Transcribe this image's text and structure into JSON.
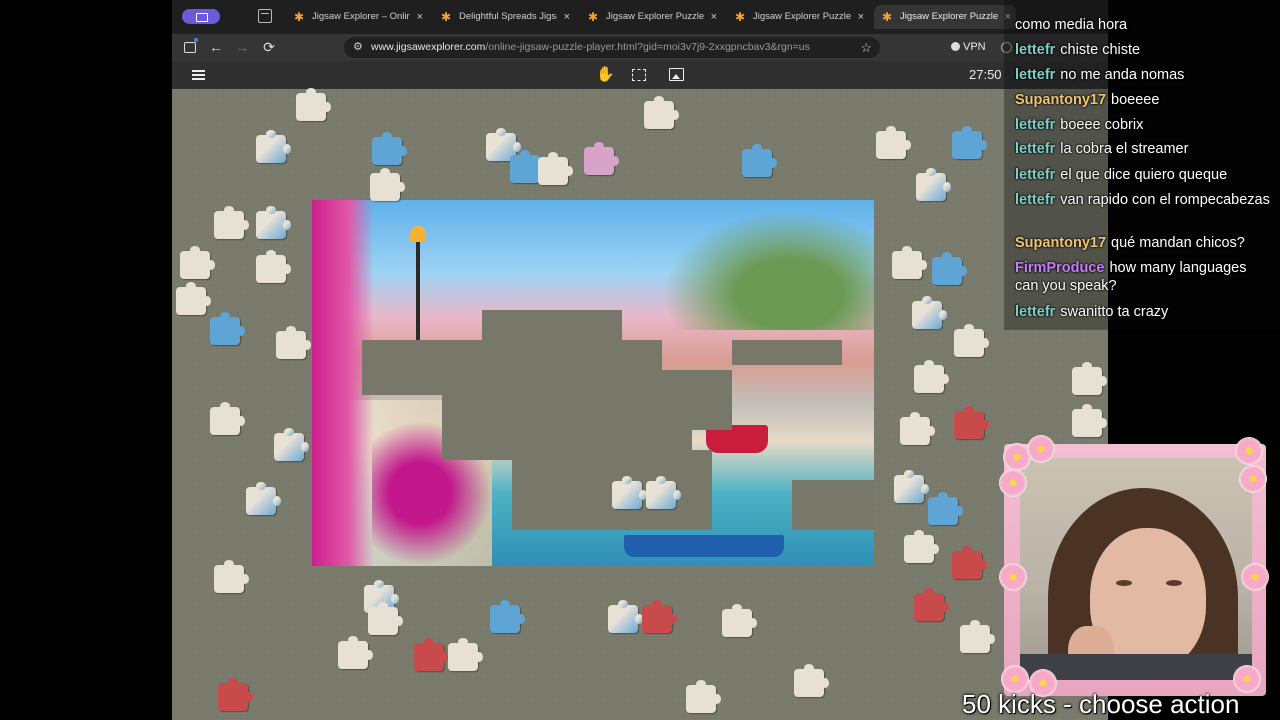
{
  "browser": {
    "tabs": [
      {
        "label": "Jigsaw Explorer – Online Jig",
        "active": false
      },
      {
        "label": "Delightful Spreads Jigsaw P",
        "active": false
      },
      {
        "label": "Jigsaw Explorer Puzzle Play",
        "active": false
      },
      {
        "label": "Jigsaw Explorer Puzzle Play",
        "active": false
      },
      {
        "label": "Jigsaw Explorer Puzzle Play",
        "active": true
      }
    ],
    "tab_close": "×",
    "url_host": "www.jigsawexplorer.com",
    "url_path": "/online-jigsaw-puzzle-player.html?gid=moi3v7j9-2xxgpncbav3&rgn=us",
    "vpn_label": "VPN",
    "back": "←",
    "forward": "→",
    "reload": "⟳",
    "star": "☆",
    "site_info": "⚙",
    "favicon": "✱"
  },
  "app": {
    "timer": "27:50",
    "hand": "✋"
  },
  "chat": [
    {
      "user": "",
      "msg": "como media hora",
      "color": "#ffffff"
    },
    {
      "user": "lettefr",
      "msg": "chiste chiste",
      "color": "#7ecfc8"
    },
    {
      "user": "lettefr",
      "msg": "no me anda nomas",
      "color": "#7ecfc8"
    },
    {
      "user": "Supantony17",
      "msg": "boeeee",
      "color": "#f0c674"
    },
    {
      "user": "lettefr",
      "msg": "boeee cobrix",
      "color": "#7ecfc8"
    },
    {
      "user": "lettefr",
      "msg": "la cobra el streamer",
      "color": "#7ecfc8"
    },
    {
      "user": "lettefr",
      "msg": "el que dice quiero queque",
      "color": "#7ecfc8"
    },
    {
      "user": "lettefr",
      "msg": "van rapido con el rompecabezas",
      "color": "#7ecfc8"
    },
    {
      "user": "Supantony17",
      "msg": "qué mandan chicos?",
      "color": "#f0c674"
    },
    {
      "user": "FirmProduce",
      "msg": "how many languages can you speak?",
      "color": "#c77dff"
    },
    {
      "user": "lettefr",
      "msg": "swanitto ta crazy",
      "color": "#7ecfc8"
    }
  ],
  "overlay": {
    "kicks_banner": "50 kicks - choose action"
  }
}
